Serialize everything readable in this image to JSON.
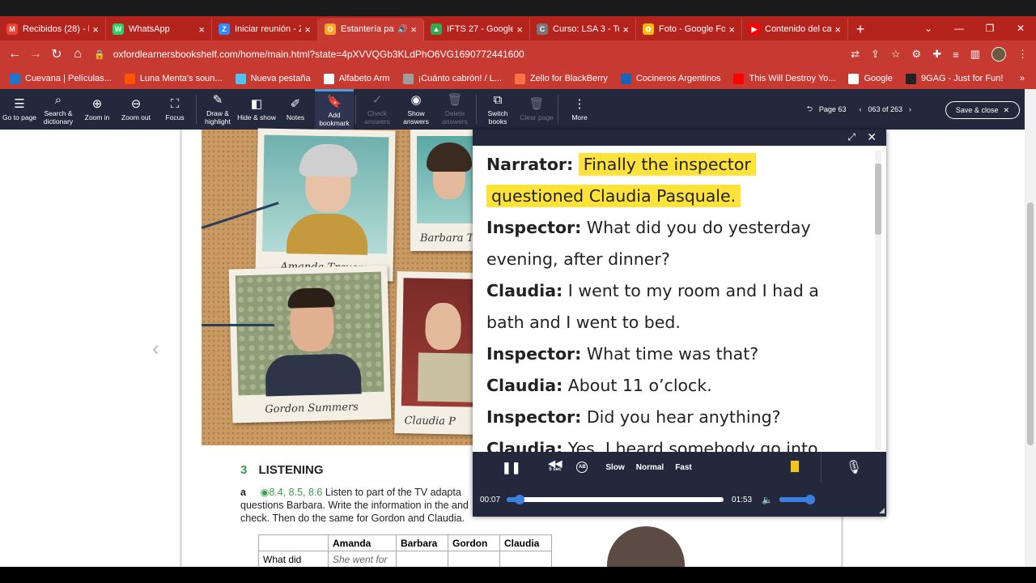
{
  "browser": {
    "tabs": [
      {
        "title": "Recibidos (28) - la",
        "favicon_color": "#ea4335",
        "glyph": "M"
      },
      {
        "title": "WhatsApp",
        "favicon_color": "#25d366",
        "glyph": "W"
      },
      {
        "title": "Iniciar reunión - Z",
        "favicon_color": "#2d8cff",
        "glyph": "Z"
      },
      {
        "title": "Estantería pa",
        "favicon_color": "#f9a825",
        "glyph": "O"
      },
      {
        "title": "IFTS 27 - Google",
        "favicon_color": "#34a853",
        "glyph": "▲"
      },
      {
        "title": "Curso: LSA 3 - Te",
        "favicon_color": "#777777",
        "glyph": "C"
      },
      {
        "title": "Foto - Google Fo",
        "favicon_color": "#fbbc05",
        "glyph": "✿"
      },
      {
        "title": "Contenido del ca",
        "favicon_color": "#ff0000",
        "glyph": "▶"
      }
    ],
    "url": "oxfordlearnersbookshelf.com/home/main.html?state=4pXVVQGb3KLdPhO6VG1690772441600",
    "bookmarks": [
      {
        "label": "Cuevana | Películas...",
        "color": "#1976d2"
      },
      {
        "label": "Luna Menta's soun...",
        "color": "#ff5500"
      },
      {
        "label": "Nueva pestaña",
        "color": "#4fc3f7"
      },
      {
        "label": "Alfabeto Arm",
        "color": "#ffffff"
      },
      {
        "label": "¡Cuánto cabrón! / L...",
        "color": "#9e9e9e"
      },
      {
        "label": "Zello for BlackBerry",
        "color": "#ff7043"
      },
      {
        "label": "Cocineros Argentinos",
        "color": "#1565c0"
      },
      {
        "label": "This Will Destroy Yo...",
        "color": "#ff0000"
      },
      {
        "label": "Google",
        "color": "#ffffff"
      },
      {
        "label": "9GAG - Just for Fun!",
        "color": "#222222"
      }
    ]
  },
  "toolbar": {
    "items": [
      {
        "label": "Go to page",
        "icon": "☰",
        "name": "go-to-page-button",
        "disabled": false
      },
      {
        "label": "Search & dictionary",
        "icon": "⌕",
        "name": "search-dictionary-button",
        "disabled": false
      },
      {
        "label": "Zoom in",
        "icon": "⊕",
        "name": "zoom-in-button",
        "disabled": false
      },
      {
        "label": "Zoom out",
        "icon": "⊖",
        "name": "zoom-out-button",
        "disabled": false
      },
      {
        "label": "Focus",
        "icon": "⛶",
        "name": "focus-button",
        "disabled": false
      },
      {
        "label": "Draw & highlight",
        "icon": "✎",
        "name": "draw-highlight-button",
        "disabled": false
      },
      {
        "label": "Hide & show",
        "icon": "◧",
        "name": "hide-show-button",
        "disabled": false
      },
      {
        "label": "Notes",
        "icon": "✐",
        "name": "notes-button",
        "disabled": false
      },
      {
        "label": "Add bookmark",
        "icon": "🔖",
        "name": "add-bookmark-button",
        "disabled": false
      },
      {
        "label": "Check answers",
        "icon": "✓",
        "name": "check-answers-button",
        "disabled": true
      },
      {
        "label": "Show answers",
        "icon": "◉",
        "name": "show-answers-button",
        "disabled": false
      },
      {
        "label": "Delete answers",
        "icon": "🗑",
        "name": "delete-answers-button",
        "disabled": true
      },
      {
        "label": "Switch books",
        "icon": "⧉",
        "name": "switch-books-button",
        "disabled": false
      },
      {
        "label": "Clear page",
        "icon": "🗑",
        "name": "clear-page-button",
        "disabled": true
      },
      {
        "label": "More",
        "icon": "⋮",
        "name": "more-button",
        "disabled": false
      }
    ],
    "page_label": "Page 63",
    "page_count": "063 of 263",
    "save_close": "Save & close"
  },
  "book": {
    "captions": [
      "Amanda Travers",
      "Barbara T",
      "Gordon Summers",
      "Claudia P"
    ],
    "section_number": "3",
    "section_title": "LISTENING",
    "ex_label": "a",
    "audio_refs": "8.4, 8.5, 8.6",
    "instructions": "Listen to part of the TV adapta questions Barbara. Write the information in the and check. Then do the same for Gordon and Claudia.",
    "table": {
      "headers": [
        "",
        "Amanda",
        "Barbara",
        "Gordon",
        "Claudia"
      ],
      "row_label": "What did",
      "row_amanda": "She went for"
    }
  },
  "transcript": {
    "lines": [
      {
        "speaker": "Narrator:",
        "text": "Finally the inspector",
        "highlight": true
      },
      {
        "speaker": "",
        "text": "questioned Claudia Pasquale.",
        "highlight": true
      },
      {
        "speaker": "Inspector:",
        "text": "What did you do yesterday",
        "highlight": false
      },
      {
        "speaker": "",
        "text": "evening, after dinner?",
        "highlight": false
      },
      {
        "speaker": "Claudia:",
        "text": "I went to my room and I had a",
        "highlight": false
      },
      {
        "speaker": "",
        "text": "bath and I went to bed.",
        "highlight": false
      },
      {
        "speaker": "Inspector:",
        "text": "What time was that?",
        "highlight": false
      },
      {
        "speaker": "Claudia:",
        "text": "About 11 o’clock.",
        "highlight": false
      },
      {
        "speaker": "Inspector:",
        "text": "Did you hear anything?",
        "highlight": false
      },
      {
        "speaker": "Claudia:",
        "text": "Yes, I heard somebody go into",
        "highlight": false
      }
    ],
    "highlight_color": "#ffe23a"
  },
  "player": {
    "speeds": [
      "Slow",
      "Normal",
      "Fast"
    ],
    "rewind_label": "5 sec",
    "ab_label": "AB",
    "current_time": "00:07",
    "total_time": "01:53",
    "progress": 0.06,
    "volume": 0.9
  }
}
